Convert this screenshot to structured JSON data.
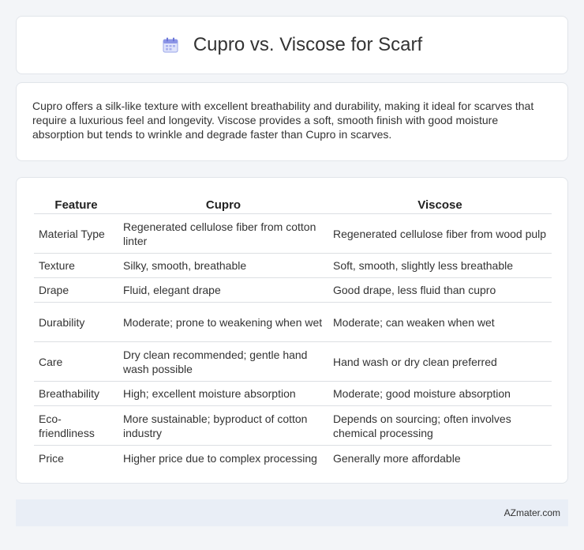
{
  "header": {
    "icon": "calendar-icon",
    "title": "Cupro vs. Viscose for Scarf"
  },
  "summary": {
    "text": "Cupro offers a silk-like texture with excellent breathability and durability, making it ideal for scarves that require a luxurious feel and longevity. Viscose provides a soft, smooth finish with good moisture absorption but tends to wrinkle and degrade faster than Cupro in scarves."
  },
  "table": {
    "headers": [
      "Feature",
      "Cupro",
      "Viscose"
    ],
    "rows": [
      [
        "Material Type",
        "Regenerated cellulose fiber from cotton linter",
        "Regenerated cellulose fiber from wood pulp"
      ],
      [
        "Texture",
        "Silky, smooth, breathable",
        "Soft, smooth, slightly less breathable"
      ],
      [
        "Drape",
        "Fluid, elegant drape",
        "Good drape, less fluid than cupro"
      ],
      [
        "Durability",
        "Moderate; prone to weakening when wet",
        "Moderate; can weaken when wet"
      ],
      [
        "Care",
        "Dry clean recommended; gentle hand wash possible",
        "Hand wash or dry clean preferred"
      ],
      [
        "Breathability",
        "High; excellent moisture absorption",
        "Moderate; good moisture absorption"
      ],
      [
        "Eco-friendliness",
        "More sustainable; byproduct of cotton industry",
        "Depends on sourcing; often involves chemical processing"
      ],
      [
        "Price",
        "Higher price due to complex processing",
        "Generally more affordable"
      ]
    ]
  },
  "footer": {
    "text": "AZmater.com"
  }
}
